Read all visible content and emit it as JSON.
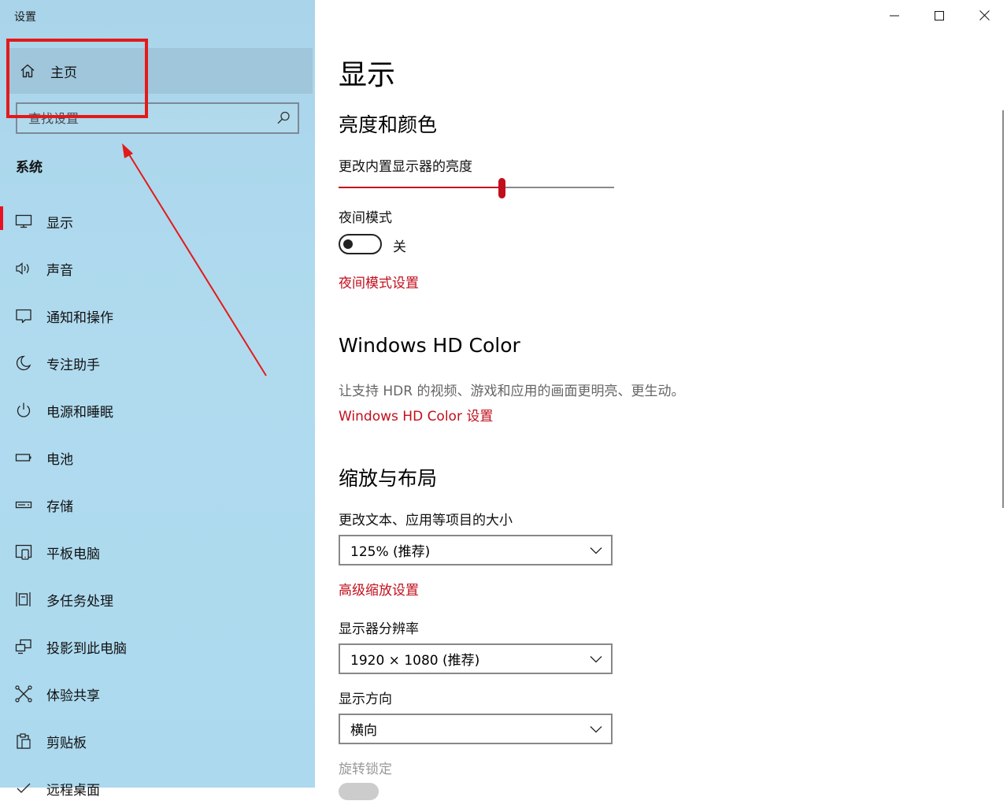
{
  "window": {
    "title": "设置",
    "controls": {
      "minimize": "minimize",
      "maximize": "maximize",
      "close": "close"
    }
  },
  "sidebar": {
    "home_label": "主页",
    "search_placeholder": "查找设置",
    "section": "系统",
    "items": [
      {
        "label": "显示",
        "icon": "monitor-icon",
        "active": true
      },
      {
        "label": "声音",
        "icon": "speaker-icon"
      },
      {
        "label": "通知和操作",
        "icon": "notification-icon"
      },
      {
        "label": "专注助手",
        "icon": "moon-icon"
      },
      {
        "label": "电源和睡眠",
        "icon": "power-icon"
      },
      {
        "label": "电池",
        "icon": "battery-icon"
      },
      {
        "label": "存储",
        "icon": "storage-icon"
      },
      {
        "label": "平板电脑",
        "icon": "tablet-icon"
      },
      {
        "label": "多任务处理",
        "icon": "multitask-icon"
      },
      {
        "label": "投影到此电脑",
        "icon": "project-icon"
      },
      {
        "label": "体验共享",
        "icon": "share-icon"
      },
      {
        "label": "剪贴板",
        "icon": "clipboard-icon"
      },
      {
        "label": "远程桌面",
        "icon": "remote-desktop-icon"
      }
    ]
  },
  "main": {
    "title": "显示",
    "brightness_section": {
      "heading": "亮度和颜色",
      "slider_label": "更改内置显示器的亮度",
      "brightness_value": 0.59
    },
    "night_mode": {
      "label": "夜间模式",
      "state": "关",
      "settings_link": "夜间模式设置"
    },
    "hd_color": {
      "heading": "Windows HD Color",
      "description": "让支持 HDR 的视频、游戏和应用的画面更明亮、更生动。",
      "link": "Windows HD Color 设置"
    },
    "scale_layout": {
      "heading": "缩放与布局",
      "text_size_label": "更改文本、应用等项目的大小",
      "text_size_value": "125% (推荐)",
      "advanced_link": "高级缩放设置",
      "resolution_label": "显示器分辨率",
      "resolution_value": "1920 × 1080 (推荐)",
      "orientation_label": "显示方向",
      "orientation_value": "横向",
      "rotation_lock_label": "旋转锁定"
    }
  },
  "colors": {
    "accent": "#c20f1c",
    "sidebar_bg": "#acd9ee",
    "annotation": "#e31a1a"
  }
}
